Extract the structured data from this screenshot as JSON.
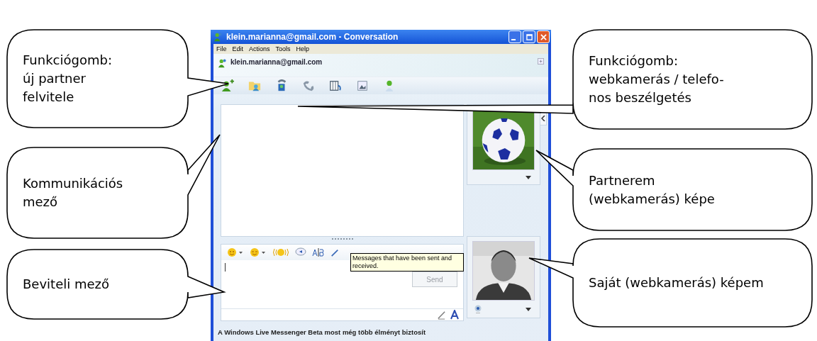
{
  "callouts": [
    {
      "text": "Funkciógomb:\núj partner\nfelvitele"
    },
    {
      "text": "Kommunikációs\nmező"
    },
    {
      "text": "Beviteli mező"
    },
    {
      "text": "Funkciógomb:\nwebkamerás / telefo-\nnos beszélgetés"
    },
    {
      "text": "Partnerem\n(webkamerás) képe"
    },
    {
      "text": "Saját (webkamerás) képem"
    }
  ],
  "window": {
    "title": "klein.marianna@gmail.com - Conversation",
    "menu": [
      "File",
      "Edit",
      "Actions",
      "Tools",
      "Help"
    ],
    "contact": "klein.marianna@gmail.com",
    "tooltip": "Messages that have been sent and received.",
    "send_button": {
      "label": "Send",
      "disabled": true
    },
    "status_text": "A Windows Live Messenger Beta most még több élményt biztosít"
  }
}
